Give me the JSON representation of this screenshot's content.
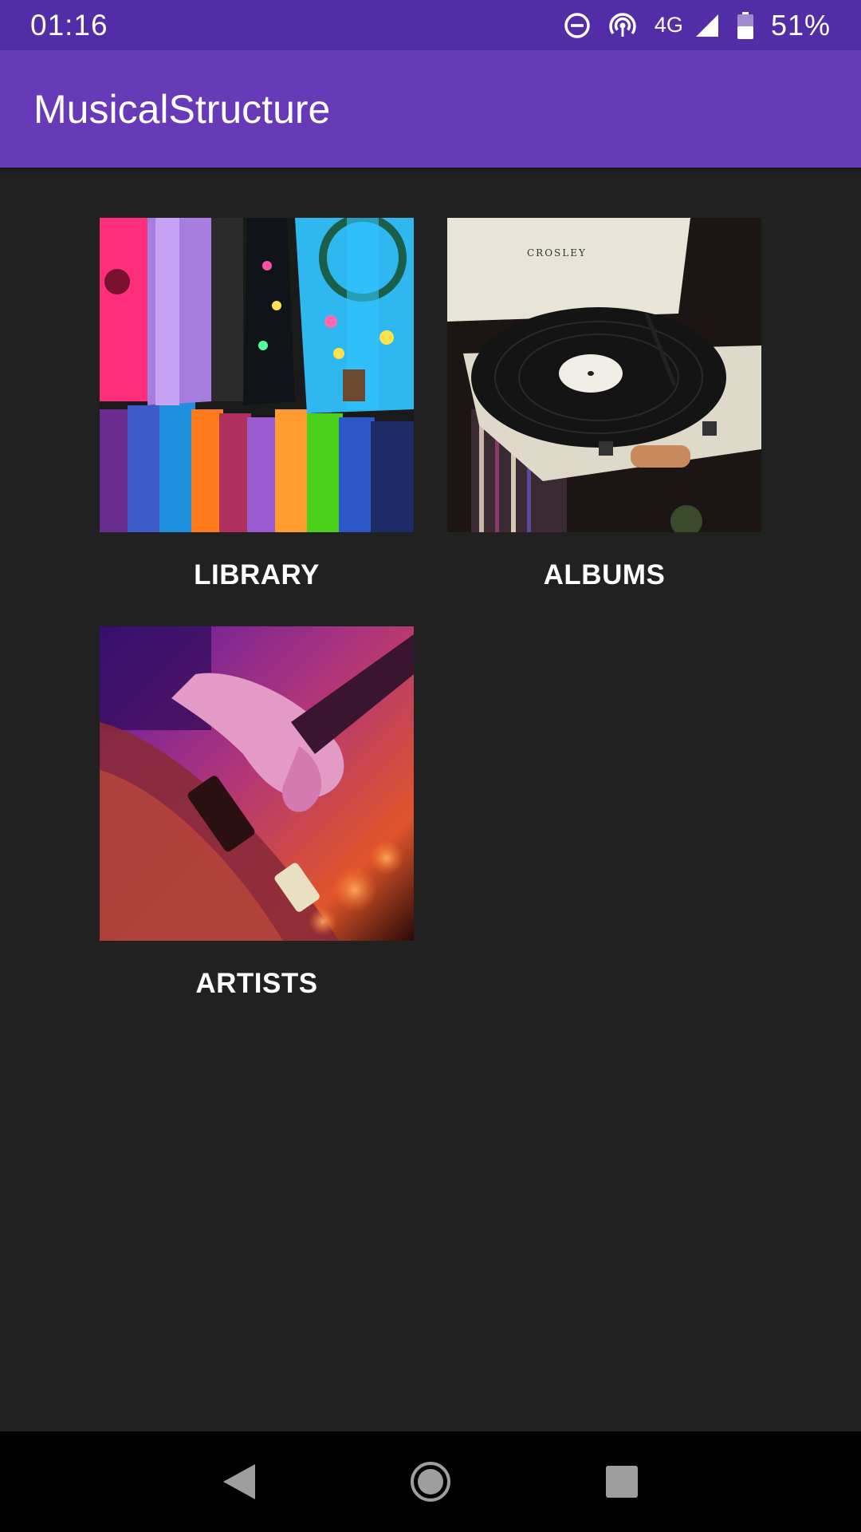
{
  "status_bar": {
    "time": "01:16",
    "network": "4G",
    "battery": "51%",
    "icons": [
      "do-not-disturb-icon",
      "hotspot-icon",
      "signal-icon",
      "battery-icon"
    ]
  },
  "app_bar": {
    "title": "MusicalStructure"
  },
  "tiles": [
    {
      "label": "LIBRARY",
      "image": "colorful-guitars"
    },
    {
      "label": "ALBUMS",
      "image": "record-player"
    },
    {
      "label": "ARTISTS",
      "image": "guitarist-hand"
    }
  ],
  "nav_bar": {
    "icons": [
      "back-icon",
      "home-icon",
      "recents-icon"
    ]
  },
  "colors": {
    "status_bar": "#512DA8",
    "app_bar": "#673AB7",
    "background": "#212121",
    "nav_bar": "#000000"
  }
}
